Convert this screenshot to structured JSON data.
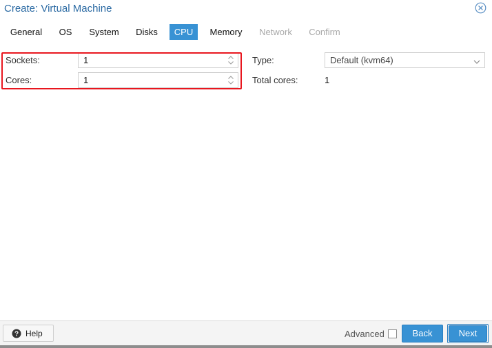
{
  "window": {
    "title": "Create: Virtual Machine"
  },
  "tabs": [
    {
      "label": "General",
      "state": "normal"
    },
    {
      "label": "OS",
      "state": "normal"
    },
    {
      "label": "System",
      "state": "normal"
    },
    {
      "label": "Disks",
      "state": "normal"
    },
    {
      "label": "CPU",
      "state": "active"
    },
    {
      "label": "Memory",
      "state": "normal"
    },
    {
      "label": "Network",
      "state": "disabled"
    },
    {
      "label": "Confirm",
      "state": "disabled"
    }
  ],
  "cpu": {
    "sockets_label": "Sockets:",
    "sockets_value": "1",
    "cores_label": "Cores:",
    "cores_value": "1",
    "type_label": "Type:",
    "type_value": "Default (kvm64)",
    "total_cores_label": "Total cores:",
    "total_cores_value": "1"
  },
  "footer": {
    "help_label": "Help",
    "advanced_label": "Advanced",
    "advanced_checked": false,
    "back_label": "Back",
    "next_label": "Next"
  },
  "colors": {
    "accent": "#3892d4",
    "title": "#2b6aa3",
    "highlight": "#e8161e"
  },
  "icons": {
    "close": "close-circle-icon",
    "help": "question-circle-icon",
    "spinner": "spinner-up-down-icon",
    "dropdown": "chevron-down-icon"
  }
}
